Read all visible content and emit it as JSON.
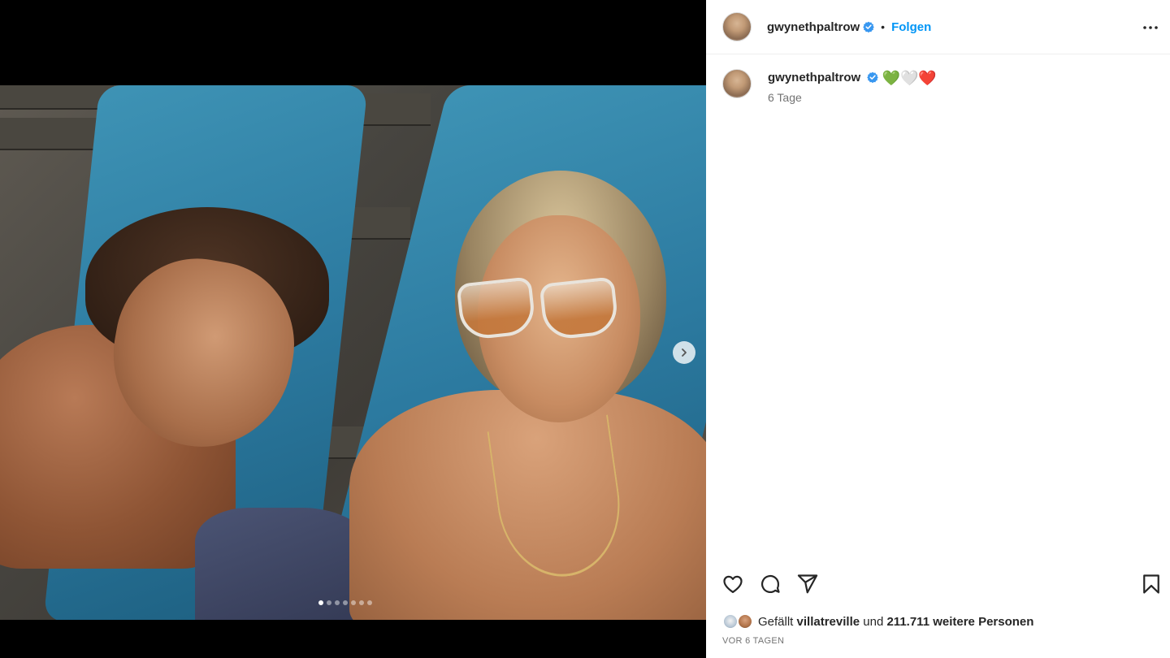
{
  "post": {
    "author": "gwynethpaltrow",
    "follow_label": "Folgen",
    "separator": "•",
    "caption_emojis": {
      "green": "💚",
      "white": "🤍",
      "red": "❤️"
    },
    "age": "6 Tage",
    "likes": {
      "prefix": "Gefällt",
      "first_user": "villatreville",
      "and": "und",
      "others": "211.711 weitere Personen"
    },
    "date": "VOR 6 TAGEN"
  },
  "carousel": {
    "total_slides": 7,
    "active_index": 0
  },
  "icons": {
    "verified": "verified-badge-icon",
    "more": "more-options-icon",
    "like": "heart-icon",
    "comment": "comment-icon",
    "share": "paper-plane-icon",
    "save": "bookmark-icon",
    "next": "chevron-right-icon"
  },
  "colors": {
    "accent": "#0095f6",
    "text": "#262626",
    "muted": "#737373"
  }
}
